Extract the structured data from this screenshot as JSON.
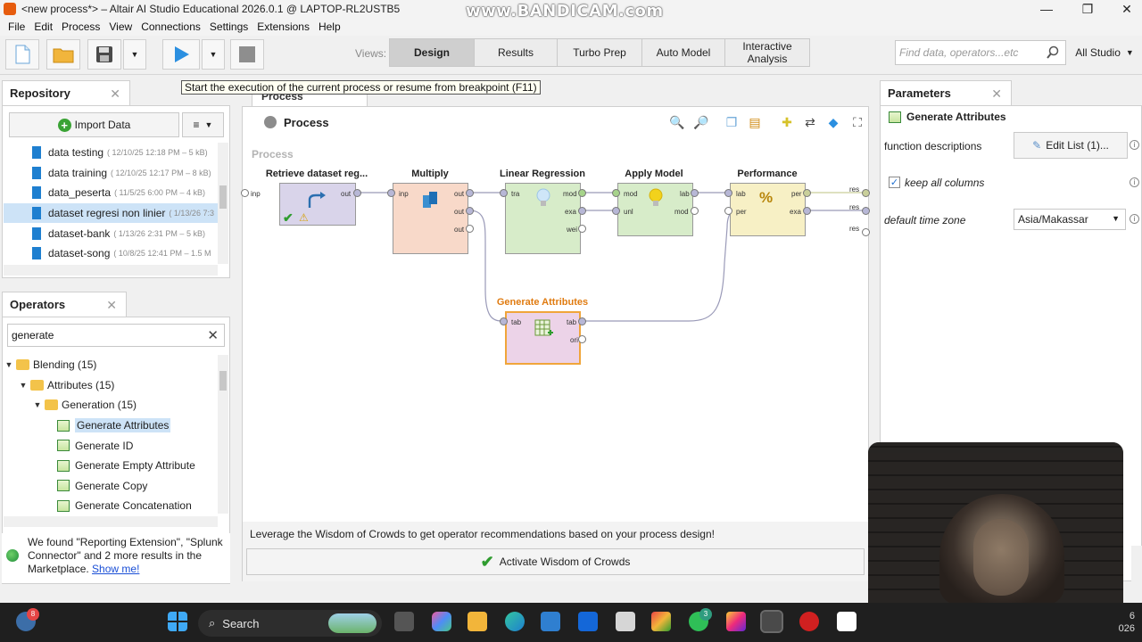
{
  "window": {
    "title": "<new process*> – Altair AI Studio Educational 2026.0.1 @ LAPTOP-RL2USTB5",
    "watermark": "www.BANDICAM.com",
    "minimize": "—",
    "maximize": "❐",
    "close": "✕"
  },
  "menu": {
    "items": [
      {
        "label": "File"
      },
      {
        "label": "Edit"
      },
      {
        "label": "Process"
      },
      {
        "label": "View"
      },
      {
        "label": "Connections"
      },
      {
        "label": "Settings"
      },
      {
        "label": "Extensions"
      },
      {
        "label": "Help"
      }
    ]
  },
  "toolbar": {
    "views_label": "Views:",
    "views": [
      {
        "label": "Design",
        "active": true
      },
      {
        "label": "Results",
        "active": false
      },
      {
        "label": "Turbo Prep",
        "active": false
      },
      {
        "label": "Auto Model",
        "active": false
      },
      {
        "label": "Interactive Analysis",
        "active": false
      }
    ],
    "search_placeholder": "Find data, operators...etc",
    "studio_label": "All Studio",
    "run_tooltip": "Start the execution of the current process or resume from breakpoint (F11)"
  },
  "repository": {
    "title": "Repository",
    "import_label": "Import Data",
    "menu_label": "≡",
    "items": [
      {
        "name": "data testing",
        "meta": "( 12/10/25 12:18 PM – 5 kB)",
        "selected": false
      },
      {
        "name": "data training",
        "meta": "( 12/10/25 12:17 PM – 8 kB)",
        "selected": false
      },
      {
        "name": "data_peserta",
        "meta": "( 11/5/25 6:00 PM – 4 kB)",
        "selected": false
      },
      {
        "name": "dataset regresi non linier",
        "meta": "( 1/13/26 7:3",
        "selected": true
      },
      {
        "name": "dataset-bank",
        "meta": "( 1/13/26 2:31 PM – 5 kB)",
        "selected": false
      },
      {
        "name": "dataset-song",
        "meta": "( 10/8/25 12:41 PM – 1.5 M",
        "selected": false
      }
    ]
  },
  "operators": {
    "title": "Operators",
    "search_value": "generate",
    "tree": [
      {
        "label": "Blending (15)",
        "level": 0,
        "kind": "folder"
      },
      {
        "label": "Attributes (15)",
        "level": 1,
        "kind": "folder"
      },
      {
        "label": "Generation (15)",
        "level": 2,
        "kind": "folder"
      },
      {
        "label": "Generate Attributes",
        "level": 3,
        "kind": "op",
        "selected": true
      },
      {
        "label": "Generate ID",
        "level": 3,
        "kind": "op"
      },
      {
        "label": "Generate Empty Attribute",
        "level": 3,
        "kind": "op"
      },
      {
        "label": "Generate Copy",
        "level": 3,
        "kind": "op"
      },
      {
        "label": "Generate Concatenation",
        "level": 3,
        "kind": "op"
      }
    ],
    "notice_text": "We found \"Reporting Extension\", \"Splunk Connector\" and 2 more results in the Marketplace.",
    "notice_link": "Show me!"
  },
  "process": {
    "tab_label": "Process",
    "header_name": "Process",
    "canvas_label": "Process",
    "operators": [
      {
        "name": "Retrieve dataset reg...",
        "ports_in": [],
        "ports_out": [
          "out"
        ],
        "color": "#d9d4ea"
      },
      {
        "name": "Multiply",
        "ports_in": [
          "inp"
        ],
        "ports_out": [
          "out",
          "out",
          "out"
        ],
        "color": "#f8d9c9"
      },
      {
        "name": "Linear Regression",
        "ports_in": [
          "tra"
        ],
        "ports_out": [
          "mod",
          "exa",
          "wei"
        ],
        "color": "#d7ecc9"
      },
      {
        "name": "Apply Model",
        "ports_in": [
          "mod",
          "unl"
        ],
        "ports_out": [
          "lab",
          "mod"
        ],
        "color": "#d7ecc9"
      },
      {
        "name": "Performance",
        "ports_in": [
          "lab",
          "per"
        ],
        "ports_out": [
          "per",
          "exa"
        ],
        "color": "#f7f0c5"
      },
      {
        "name": "Generate Attributes",
        "ports_in": [
          "tab"
        ],
        "ports_out": [
          "tab",
          "ori"
        ],
        "color": "#ecd3e8"
      }
    ],
    "left_port": "inp",
    "right_ports": [
      "res",
      "res",
      "res"
    ],
    "wisdom_text": "Leverage the Wisdom of Crowds to get operator recommendations based on your process design!",
    "wisdom_button": "Activate Wisdom of Crowds"
  },
  "parameters": {
    "title": "Parameters",
    "operator": "Generate Attributes",
    "function_descriptions_label": "function descriptions",
    "edit_list_label": "Edit List (1)...",
    "keep_all_columns_label": "keep all columns",
    "keep_all_columns_checked": true,
    "time_zone_label": "default time zone",
    "time_zone_value": "Asia/Makassar"
  },
  "taskbar": {
    "search_label": "Search",
    "weather_badge": "8",
    "whatsapp_badge": "3",
    "clock_top": "6",
    "clock_bottom": "026"
  },
  "colors": {
    "accent": "#1e7fd0",
    "active_view": "#cfcfcf",
    "canvas": "#ffffff",
    "generate_attributes_title": "#e07b10"
  }
}
